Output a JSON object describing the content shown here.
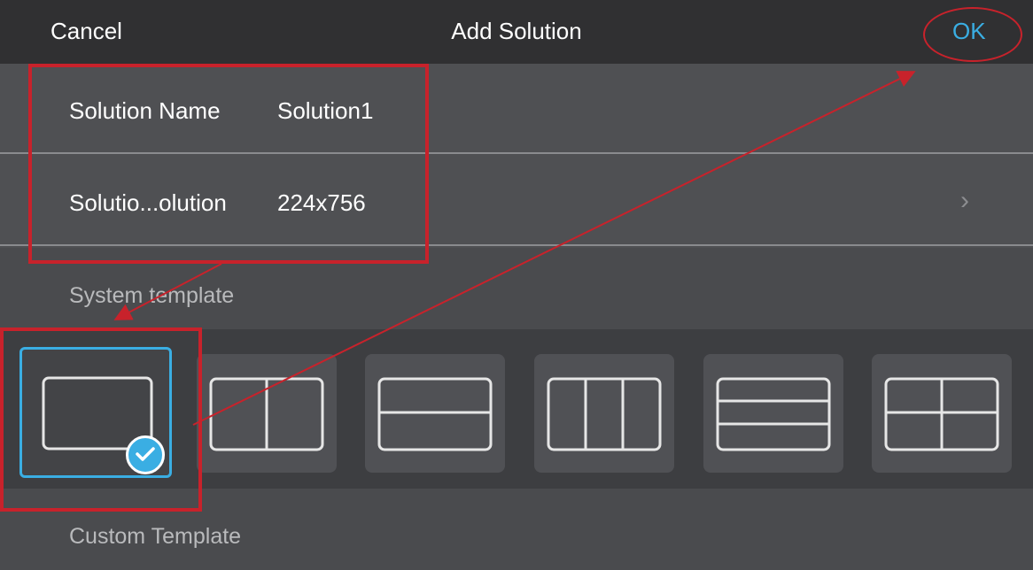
{
  "header": {
    "cancel_label": "Cancel",
    "title": "Add Solution",
    "ok_label": "OK"
  },
  "form": {
    "name_label": "Solution Name",
    "name_value": "Solution1",
    "resolution_label": "Solutio...olution",
    "resolution_value": "224x756"
  },
  "sections": {
    "system_template": "System template",
    "custom_template": "Custom Template"
  },
  "templates": [
    {
      "name": "single",
      "selected": true
    },
    {
      "name": "two-columns",
      "selected": false
    },
    {
      "name": "two-rows",
      "selected": false
    },
    {
      "name": "three-columns",
      "selected": false
    },
    {
      "name": "three-rows",
      "selected": false
    },
    {
      "name": "four-grid",
      "selected": false
    }
  ],
  "icons": {
    "chevron": "chevron-right-icon",
    "check": "checkmark-icon"
  },
  "colors": {
    "accent": "#3aaee3",
    "annotation": "#c8222b",
    "header_bg": "#303032",
    "panel_bg": "#4f5053"
  }
}
